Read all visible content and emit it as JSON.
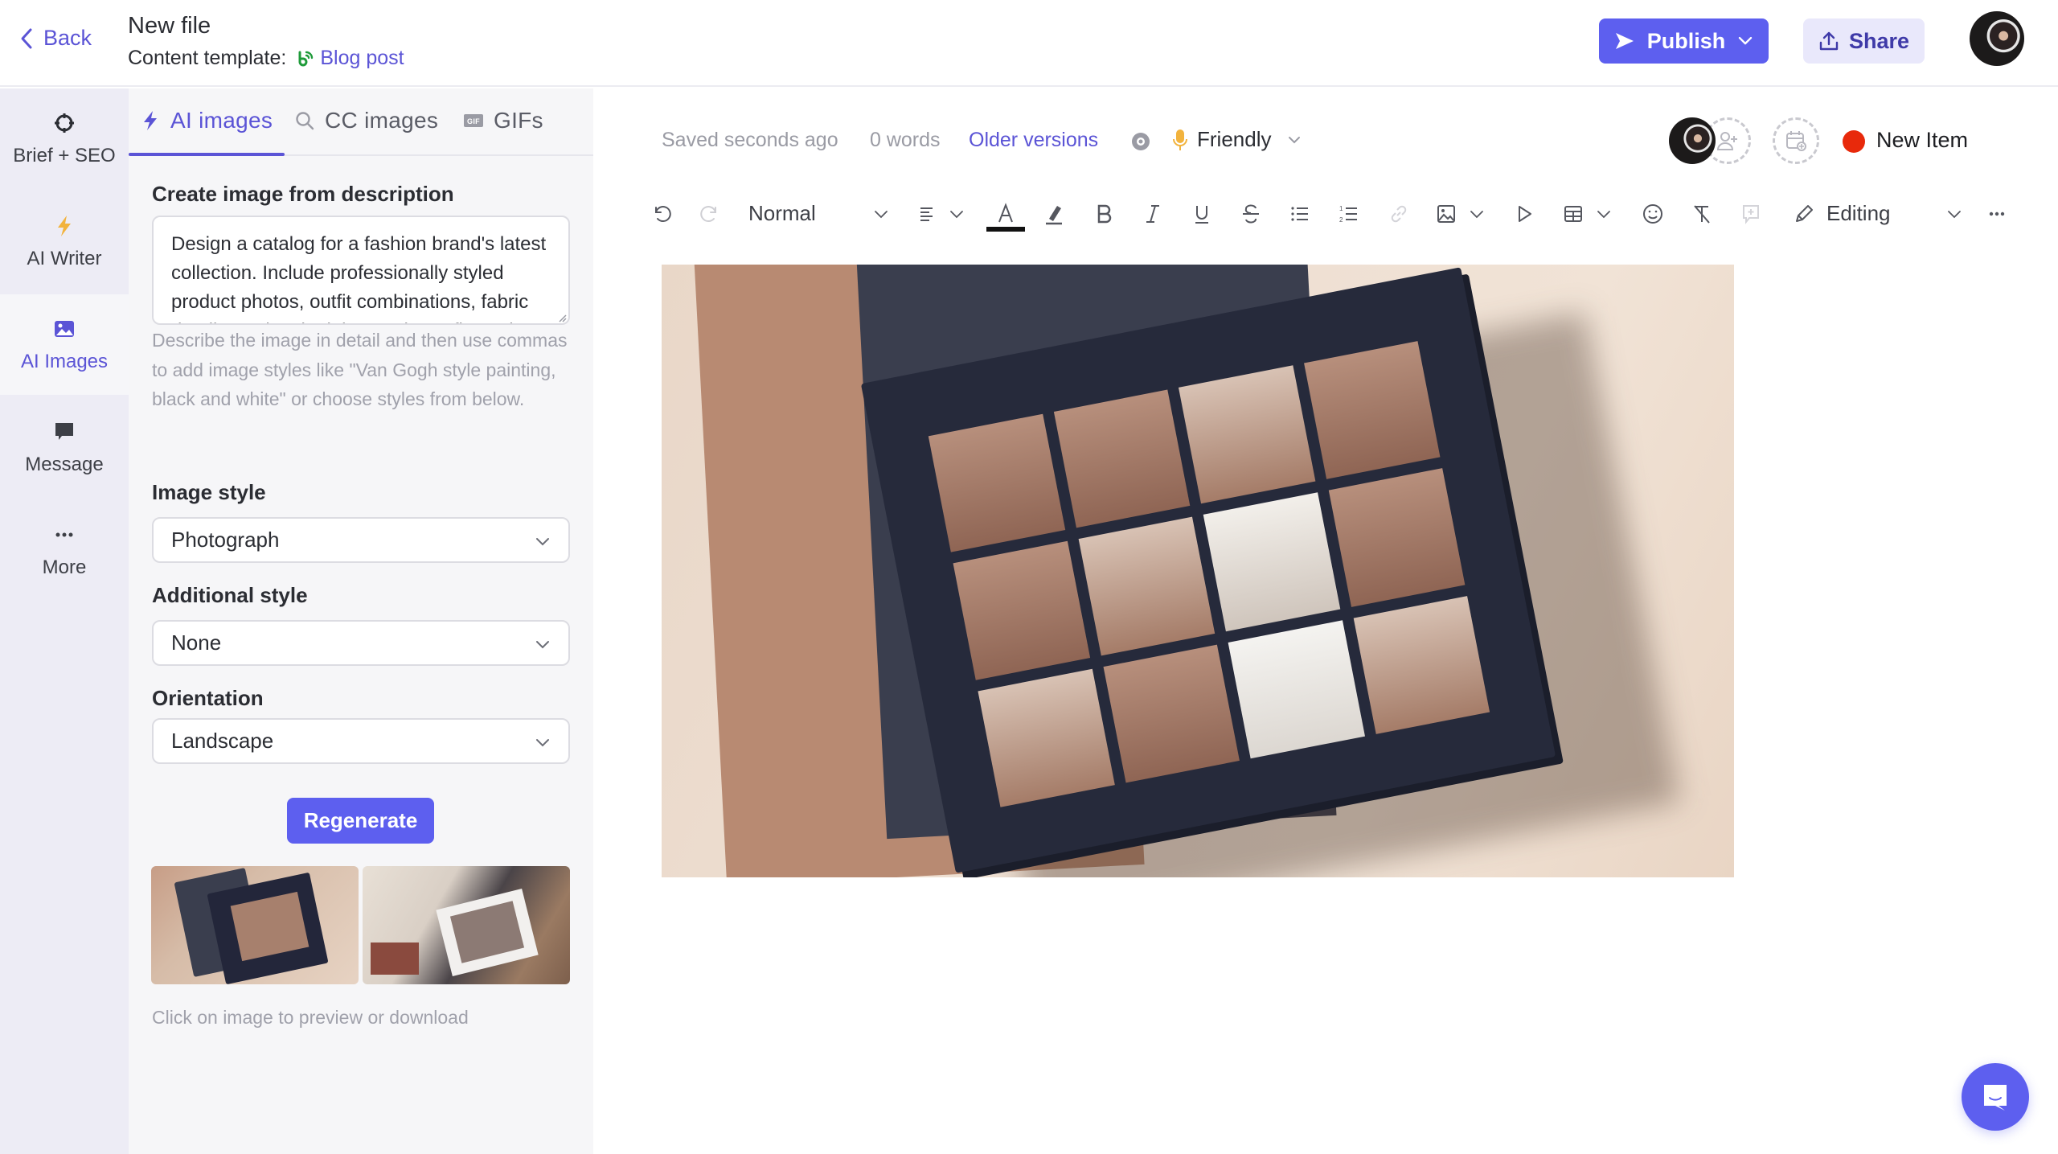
{
  "header": {
    "back_label": "Back",
    "file_title": "New file",
    "template_prefix": "Content template:",
    "template_name": "Blog post",
    "publish_label": "Publish",
    "share_label": "Share"
  },
  "rail": {
    "items": [
      {
        "label": "Brief + SEO",
        "icon": "crosshair-icon",
        "active": false
      },
      {
        "label": "AI Writer",
        "icon": "lightning-icon",
        "active": false
      },
      {
        "label": "AI Images",
        "icon": "image-icon",
        "active": true
      },
      {
        "label": "Message",
        "icon": "message-icon",
        "active": false
      },
      {
        "label": "More",
        "icon": "more-icon",
        "active": false
      }
    ]
  },
  "panel": {
    "tabs": [
      {
        "label": "AI images",
        "icon": "lightning-icon",
        "active": true
      },
      {
        "label": "CC images",
        "icon": "search-icon",
        "active": false
      },
      {
        "label": "GIFs",
        "icon": "gif-icon",
        "active": false
      }
    ],
    "prompt_label": "Create image from description",
    "prompt_value": "Design a catalog for a fashion brand's latest collection. Include professionally styled product photos, outfit combinations, fabric details, and a sleek layout that reflects the",
    "prompt_hint": "Describe the image in detail and then use commas to add image styles like \"Van Gogh style painting, black and white\" or choose styles from below.",
    "image_style_label": "Image style",
    "image_style_value": "Photograph",
    "additional_style_label": "Additional style",
    "additional_style_value": "None",
    "orientation_label": "Orientation",
    "orientation_value": "Landscape",
    "regenerate_label": "Regenerate",
    "thumbnails": [
      {
        "description": "Fashion catalog on dark cover with grid of product photos"
      },
      {
        "description": "Flat-lay of fashion lookbook pages with accessories and fabric"
      }
    ],
    "footnote": "Click on image to preview or download"
  },
  "editor": {
    "saved_status": "Saved seconds ago",
    "word_count": "0 words",
    "older_versions_label": "Older versions",
    "tone_value": "Friendly",
    "status_label": "New Item",
    "status_color": "#e8290b",
    "accent_color": "#5d5fef",
    "toolbar": {
      "paragraph_style": "Normal",
      "mode_label": "Editing"
    },
    "hero_image_description": "Generated image: fashion brand catalog with grid of styled product photos on a dark navy cover over a beige background"
  }
}
